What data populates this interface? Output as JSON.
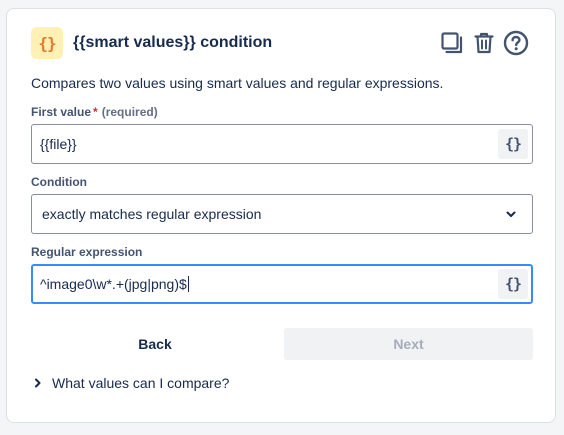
{
  "header": {
    "logo_text": "{}",
    "title": "{{smart values}} condition",
    "icons": [
      "duplicate-icon",
      "trash-icon",
      "help-icon"
    ]
  },
  "description": "Compares two values using smart values and regular expressions.",
  "first_value": {
    "label": "First value",
    "required_marker": "*",
    "required_text": "(required)",
    "value": "{{file}}",
    "smart_button": "{}"
  },
  "condition": {
    "label": "Condition",
    "selected": "exactly matches regular expression"
  },
  "regex": {
    "label": "Regular expression",
    "value": "^image0\\w*.+(jpg|png)$",
    "smart_button": "{}"
  },
  "buttons": {
    "back": "Back",
    "next": "Next"
  },
  "help": {
    "label": "What values can I compare?"
  },
  "colors": {
    "accent": "#388bff",
    "logo_bg": "#fff0b3",
    "logo_fg": "#e2792a",
    "required": "#c9372c"
  }
}
